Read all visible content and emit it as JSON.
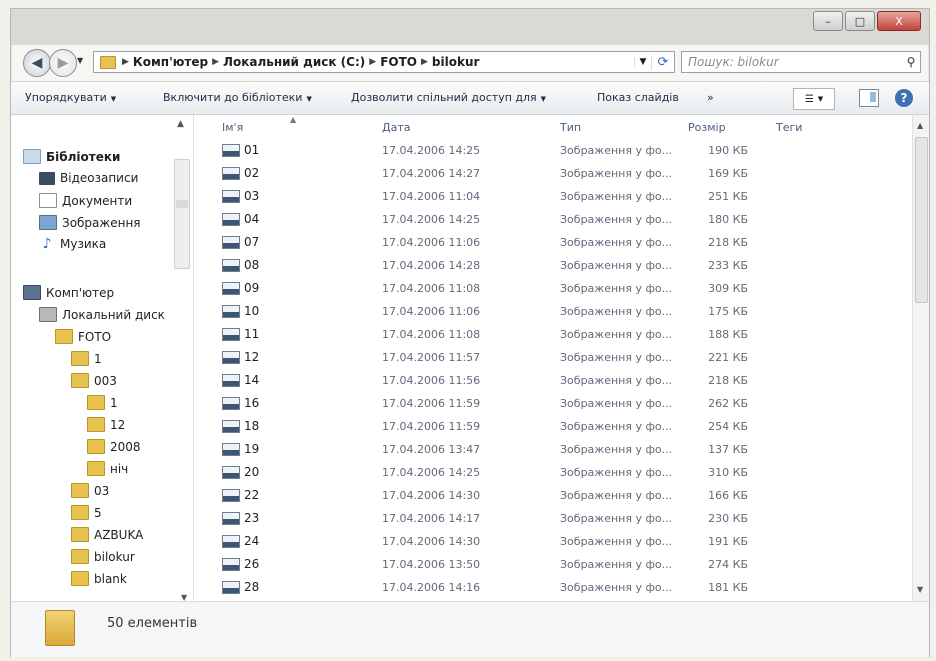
{
  "window": {
    "buttons": {
      "minimize": "–",
      "maximize": "□",
      "close": "X"
    }
  },
  "address": {
    "crumbs": [
      "Комп'ютер",
      "Локальний диск (C:)",
      "FOTO",
      "bilokur"
    ],
    "search_placeholder": "Пошук: bilokur"
  },
  "toolbar": {
    "organize": "Упорядкувати",
    "include_library": "Включити до бібліотеки",
    "share": "Дозволити спільний доступ для",
    "slideshow": "Показ слайдів",
    "more": "»",
    "help": "?"
  },
  "nav": {
    "libraries": {
      "label": "Бібліотеки",
      "items": [
        "Відеозаписи",
        "Документи",
        "Зображення",
        "Музика"
      ]
    },
    "computer": {
      "label": "Комп'ютер",
      "disk": "Локальний диск",
      "folders": [
        {
          "label": "FOTO",
          "level": 0
        },
        {
          "label": "1",
          "level": 1
        },
        {
          "label": "003",
          "level": 1
        },
        {
          "label": "1",
          "level": 2
        },
        {
          "label": "12",
          "level": 2
        },
        {
          "label": "2008",
          "level": 2
        },
        {
          "label": "ніч",
          "level": 2
        },
        {
          "label": "03",
          "level": 1
        },
        {
          "label": "5",
          "level": 1
        },
        {
          "label": "AZBUKA",
          "level": 1
        },
        {
          "label": "bilokur",
          "level": 1
        },
        {
          "label": "blank",
          "level": 1
        }
      ]
    }
  },
  "columns": {
    "name": "Ім'я",
    "date": "Дата",
    "type": "Тип",
    "size": "Розмір",
    "tags": "Теги"
  },
  "files": [
    {
      "name": "01",
      "date": "17.04.2006 14:25",
      "type": "Зображення у фо...",
      "size": "190 КБ"
    },
    {
      "name": "02",
      "date": "17.04.2006 14:27",
      "type": "Зображення у фо...",
      "size": "169 КБ"
    },
    {
      "name": "03",
      "date": "17.04.2006 11:04",
      "type": "Зображення у фо...",
      "size": "251 КБ"
    },
    {
      "name": "04",
      "date": "17.04.2006 14:25",
      "type": "Зображення у фо...",
      "size": "180 КБ"
    },
    {
      "name": "07",
      "date": "17.04.2006 11:06",
      "type": "Зображення у фо...",
      "size": "218 КБ"
    },
    {
      "name": "08",
      "date": "17.04.2006 14:28",
      "type": "Зображення у фо...",
      "size": "233 КБ"
    },
    {
      "name": "09",
      "date": "17.04.2006 11:08",
      "type": "Зображення у фо...",
      "size": "309 КБ"
    },
    {
      "name": "10",
      "date": "17.04.2006 11:06",
      "type": "Зображення у фо...",
      "size": "175 КБ"
    },
    {
      "name": "11",
      "date": "17.04.2006 11:08",
      "type": "Зображення у фо...",
      "size": "188 КБ"
    },
    {
      "name": "12",
      "date": "17.04.2006 11:57",
      "type": "Зображення у фо...",
      "size": "221 КБ"
    },
    {
      "name": "14",
      "date": "17.04.2006 11:56",
      "type": "Зображення у фо...",
      "size": "218 КБ"
    },
    {
      "name": "16",
      "date": "17.04.2006 11:59",
      "type": "Зображення у фо...",
      "size": "262 КБ"
    },
    {
      "name": "18",
      "date": "17.04.2006 11:59",
      "type": "Зображення у фо...",
      "size": "254 КБ"
    },
    {
      "name": "19",
      "date": "17.04.2006 13:47",
      "type": "Зображення у фо...",
      "size": "137 КБ"
    },
    {
      "name": "20",
      "date": "17.04.2006 14:25",
      "type": "Зображення у фо...",
      "size": "310 КБ"
    },
    {
      "name": "22",
      "date": "17.04.2006 14:30",
      "type": "Зображення у фо...",
      "size": "166 КБ"
    },
    {
      "name": "23",
      "date": "17.04.2006 14:17",
      "type": "Зображення у фо...",
      "size": "230 КБ"
    },
    {
      "name": "24",
      "date": "17.04.2006 14:30",
      "type": "Зображення у фо...",
      "size": "191 КБ"
    },
    {
      "name": "26",
      "date": "17.04.2006 13:50",
      "type": "Зображення у фо...",
      "size": "274 КБ"
    },
    {
      "name": "28",
      "date": "17.04.2006 14:16",
      "type": "Зображення у фо...",
      "size": "181 КБ"
    }
  ],
  "status": {
    "count": "50 елементів"
  },
  "colors": {
    "folder": "#e8c24f",
    "accent": "#3d6fb3"
  }
}
